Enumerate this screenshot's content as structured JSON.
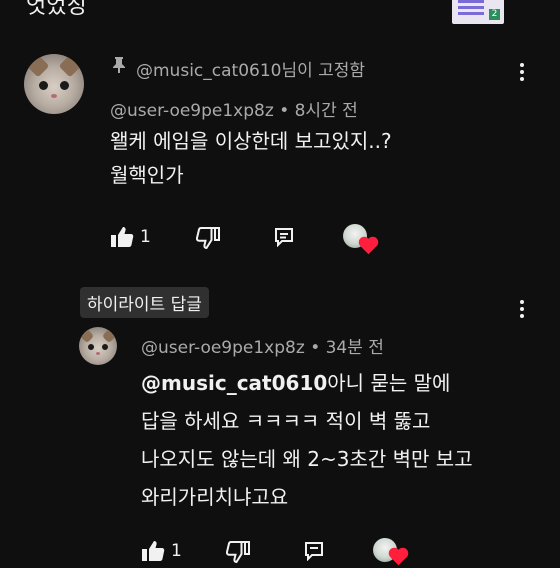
{
  "top_partial": "엇었징",
  "comment": {
    "pinned_label": "@music_cat0610님이 고정함",
    "author": "@user-oe9pe1xp8z",
    "time": "• 8시간 전",
    "text_line1": "왤케 에임을 이상한데 보고있지..?",
    "text_line2": "월핵인가",
    "likes": "1"
  },
  "reply": {
    "highlight_label": "하이라이트 답글",
    "author": "@user-oe9pe1xp8z",
    "time": "• 34분 전",
    "mention": "@music_cat0610",
    "text_line1_rest": "아니 묻는 말에",
    "text_line2": "답을 하세요 ㅋㅋㅋㅋ 적이 벽 뚫고",
    "text_line3": "나오지도 않는데 왜 2~3초간 벽만 보고",
    "text_line4": "와리가리치냐고요",
    "likes": "1"
  },
  "icons": {
    "pin": "pin-icon",
    "like": "thumb-up-icon",
    "dislike": "thumb-down-icon",
    "reply": "reply-icon",
    "more": "more-vert-icon",
    "creator_heart": "creator-heart-icon"
  },
  "colors": {
    "background": "#0f0f0f",
    "text": "#f1f1f1",
    "muted": "#aaaaaa",
    "chip": "#303030",
    "heart": "#ff1e3c"
  }
}
